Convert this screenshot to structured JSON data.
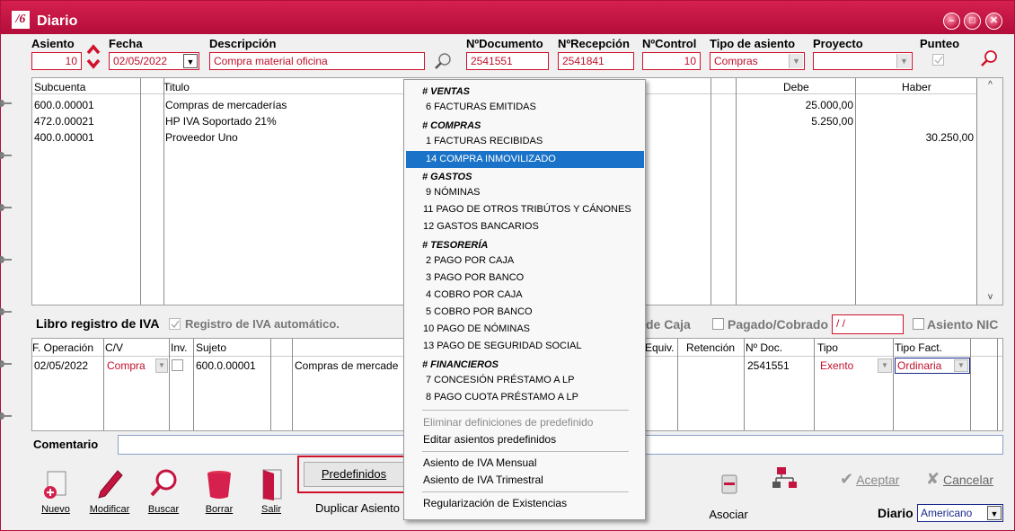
{
  "window": {
    "title": "Diario",
    "logo": "/6",
    "min_icon": "minimize-icon",
    "max_icon": "maximize-icon",
    "close_icon": "close-icon"
  },
  "header": {
    "asiento": {
      "label": "Asiento",
      "value": "10"
    },
    "fecha": {
      "label": "Fecha",
      "value": "02/05/2022"
    },
    "descripcion": {
      "label": "Descripción",
      "value": "Compra material oficina"
    },
    "num_documento": {
      "label": "NºDocumento",
      "value": "2541551"
    },
    "num_recepcion": {
      "label": "NºRecepción",
      "value": "2541841"
    },
    "num_control": {
      "label": "NºControl",
      "value": "10"
    },
    "tipo_asiento": {
      "label": "Tipo de asiento",
      "value": "Compras"
    },
    "proyecto": {
      "label": "Proyecto",
      "value": ""
    },
    "punteo": {
      "label": "Punteo"
    }
  },
  "entries": {
    "columns": [
      "Subcuenta",
      "Titulo",
      "Debe",
      "Haber"
    ],
    "rows": [
      {
        "subcuenta": "600.0.00001",
        "titulo": "Compras de mercaderías",
        "debe": "25.000,00",
        "haber": ""
      },
      {
        "subcuenta": "472.0.00021",
        "titulo": "HP IVA Soportado 21%",
        "debe": "5.250,00",
        "haber": ""
      },
      {
        "subcuenta": "400.0.00001",
        "titulo": "Proveedor Uno",
        "debe": "",
        "haber": "30.250,00"
      }
    ]
  },
  "iva": {
    "title": "Libro registro de IVA",
    "auto_label": "Registro de IVA automático.",
    "caja_label": "de Caja",
    "pagado_label": "Pagado/Cobrado",
    "pagado_value": " /  /",
    "nic_label": "Asiento NIC",
    "columns": {
      "f_operacion": "F. Operación",
      "cv": "C/V",
      "inv": "Inv.",
      "sujeto": "Sujeto",
      "equiv": "Equiv.",
      "retencion": "Retención",
      "num_doc": "Nº Doc.",
      "tipo": "Tipo",
      "tipo_fact": "Tipo Fact."
    },
    "row": {
      "f_operacion": "02/05/2022",
      "cv": "Compra",
      "sujeto": "600.0.00001",
      "desc": "Compras de mercade",
      "num_doc": "2541551",
      "tipo": "Exento",
      "tipo_fact": "Ordinaria"
    }
  },
  "comentario": {
    "label": "Comentario",
    "value": ""
  },
  "toolbar": {
    "nuevo": "Nuevo",
    "modificar": "Modificar",
    "buscar": "Buscar",
    "borrar": "Borrar",
    "salir": "Salir",
    "predefinidos": "Predefinidos",
    "duplicar": "Duplicar Asiento",
    "asociar": "Asociar",
    "aceptar": "Aceptar",
    "cancelar": "Cancelar",
    "diario_label": "Diario",
    "diario_value": "Americano"
  },
  "menu": {
    "ventas_h": "# VENTAS",
    "ventas_6": "6 FACTURAS EMITIDAS",
    "compras_h": "# COMPRAS",
    "compras_1": "1 FACTURAS RECIBIDAS",
    "compras_14": "14 COMPRA INMOVILIZADO",
    "gastos_h": "# GASTOS",
    "gastos_9": "9 NÓMINAS",
    "gastos_11": "11 PAGO DE OTROS TRIBÚTOS Y CÁNONES",
    "gastos_12": "12 GASTOS BANCARIOS",
    "tes_h": "# TESORERÍA",
    "tes_2": "2 PAGO POR CAJA",
    "tes_3": "3 PAGO POR BANCO",
    "tes_4": "4 COBRO POR CAJA",
    "tes_5": "5 COBRO POR BANCO",
    "tes_10": "10 PAGO DE NÓMINAS",
    "tes_13": "13 PAGO DE SEGURIDAD SOCIAL",
    "fin_h": "# FINANCIEROS",
    "fin_7": "7 CONCESIÓN PRÉSTAMO A LP",
    "fin_8": "8 PAGO CUOTA PRÉSTAMO A LP",
    "eliminar": "Eliminar definiciones de predefinido",
    "editar": "Editar asientos predefinidos",
    "iva_mensual": "Asiento de IVA Mensual",
    "iva_trimestral": "Asiento de IVA Trimestral",
    "regularizacion": "Regularización de Existencias"
  }
}
